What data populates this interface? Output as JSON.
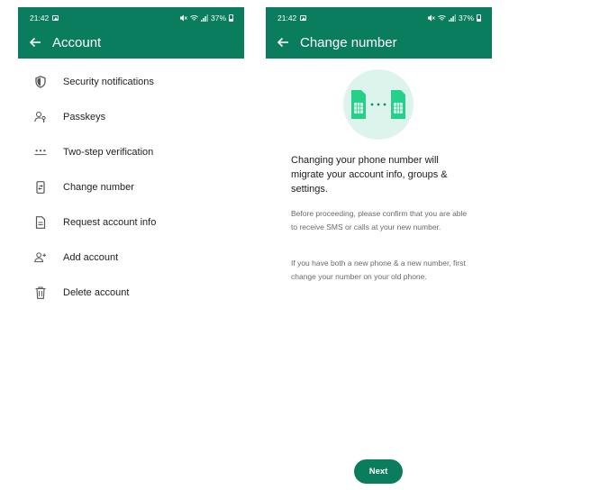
{
  "colors": {
    "brand": "#0a7d5f",
    "illustration_bg": "#dcf4ec",
    "illustration_fg": "#25d18a"
  },
  "status_bar": {
    "time": "21:42",
    "battery": "37%"
  },
  "account_screen": {
    "title": "Account",
    "items": [
      {
        "label": "Security notifications",
        "icon": "shield-icon"
      },
      {
        "label": "Passkeys",
        "icon": "passkey-icon"
      },
      {
        "label": "Two-step verification",
        "icon": "dots-icon"
      },
      {
        "label": "Change number",
        "icon": "phone-icon"
      },
      {
        "label": "Request account info",
        "icon": "document-icon"
      },
      {
        "label": "Add account",
        "icon": "add-person-icon"
      },
      {
        "label": "Delete account",
        "icon": "trash-icon"
      }
    ]
  },
  "change_number_screen": {
    "title": "Change number",
    "heading": "Changing your phone number will migrate your account info, groups & settings.",
    "paragraph1": "Before proceeding, please confirm that you are able to receive SMS or calls at your new number.",
    "paragraph2": "If you have both a new phone & a new number, first change your number on your old phone.",
    "next_label": "Next"
  }
}
